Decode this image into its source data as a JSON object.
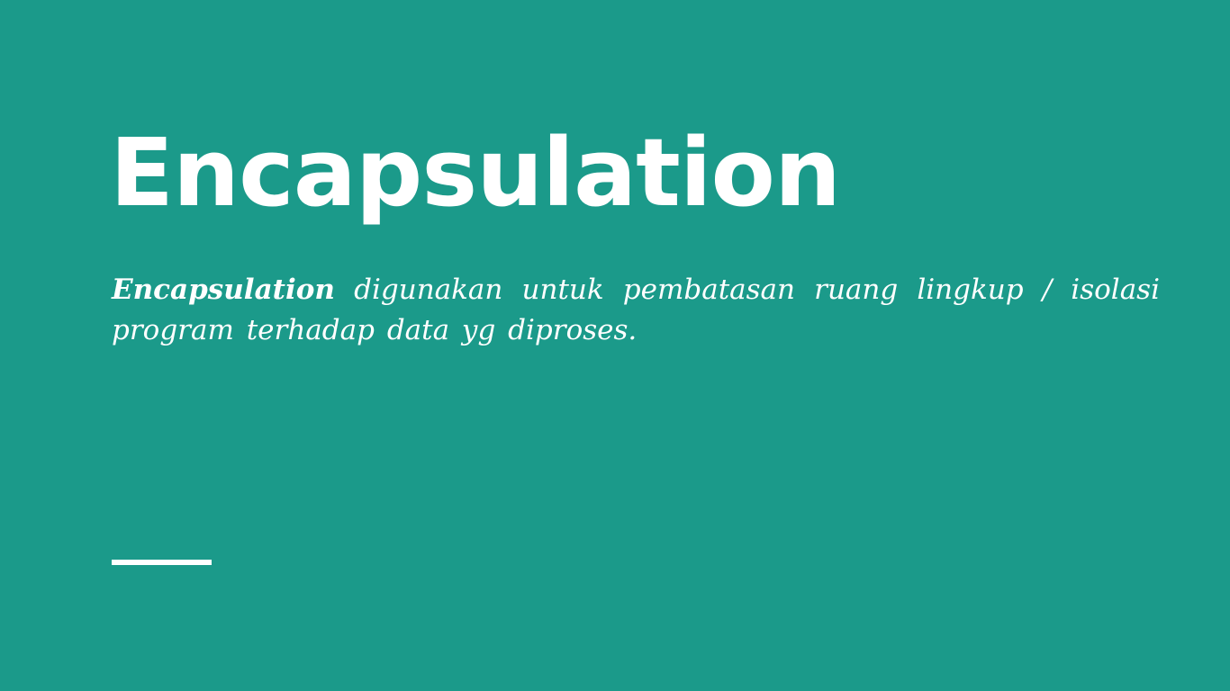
{
  "slide": {
    "title": "Encapsulation",
    "body": {
      "term": "Encapsulation",
      "text": " digunakan untuk pembatasan ruang lingkup / isolasi program terhadap data yg diproses."
    }
  },
  "colors": {
    "background": "#1b9a8a",
    "text": "#ffffff",
    "accent_bar": "#ffffff"
  }
}
